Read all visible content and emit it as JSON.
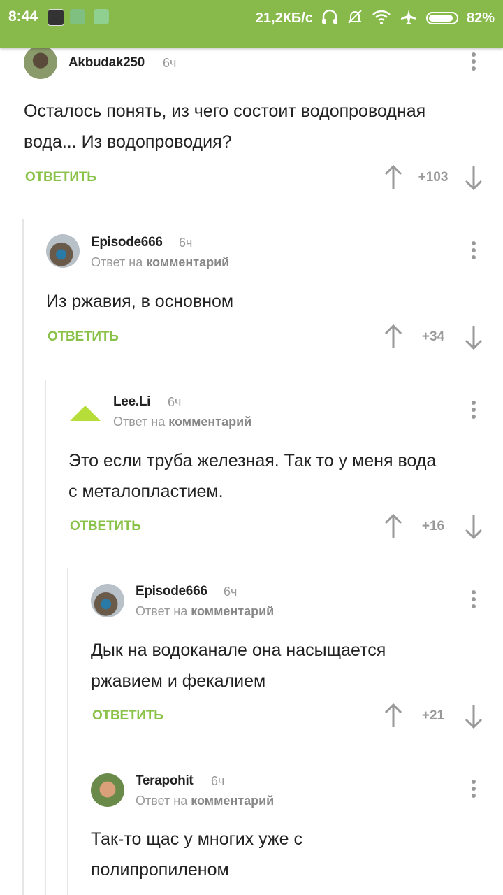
{
  "statusbar": {
    "time": "8:44",
    "net_speed": "21,2КБ/с",
    "battery": "82%",
    "icons": [
      "app-icon",
      "app-icon",
      "app-icon",
      "headphones-icon",
      "mute-icon",
      "wifi-icon",
      "airplane-icon",
      "battery-icon"
    ]
  },
  "accent": "#8ac149",
  "comments": [
    {
      "author": "Akbudak250",
      "time": "6ч",
      "text_lines": [
        "Осталось понять, из чего состоит водопроводная",
        "вода... Из водопроводия?"
      ],
      "reply": "ОТВЕТИТЬ",
      "rating": "+103"
    },
    {
      "author": "Episode666",
      "time": "6ч",
      "reply_to_prefix": "Ответ на",
      "reply_to_link": "комментарий",
      "text_lines": [
        "Из ржавия, в основном"
      ],
      "reply": "ОТВЕТИТЬ",
      "rating": "+34"
    },
    {
      "author": "Lee.Li",
      "time": "6ч",
      "reply_to_prefix": "Ответ на",
      "reply_to_link": "комментарий",
      "text_lines": [
        "Это если труба железная. Так то у меня вода",
        "с металопластием."
      ],
      "reply": "ОТВЕТИТЬ",
      "rating": "+16"
    },
    {
      "author": "Episode666",
      "time": "6ч",
      "reply_to_prefix": "Ответ на",
      "reply_to_link": "комментарий",
      "text_lines": [
        "Дык на водоканале она насыщается",
        "ржавием и фекалием"
      ],
      "reply": "ОТВЕТИТЬ",
      "rating": "+21"
    },
    {
      "author": "Terapohit",
      "time": "6ч",
      "reply_to_prefix": "Ответ на",
      "reply_to_link": "комментарий",
      "text_lines": [
        "Так-то щас у многих уже с",
        "полипропиленом"
      ]
    }
  ]
}
